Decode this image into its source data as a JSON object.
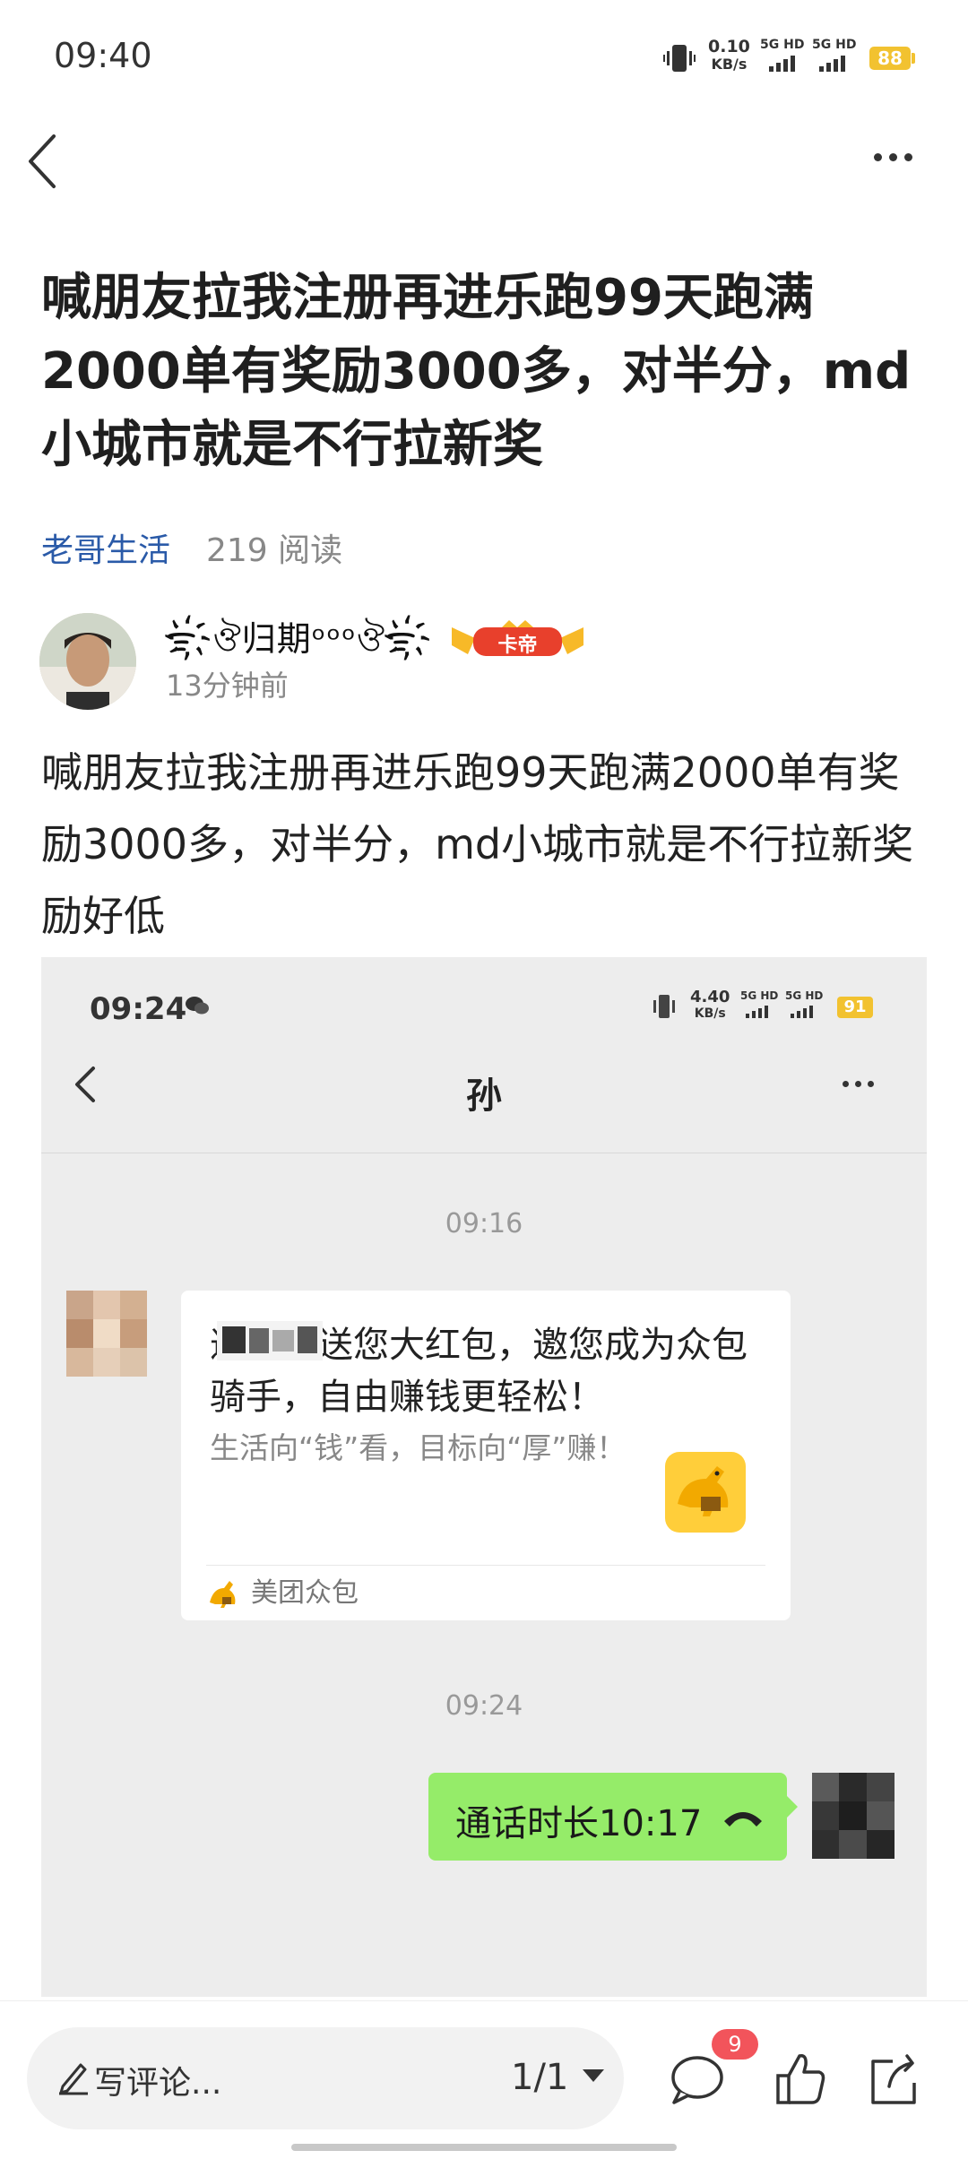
{
  "status_bar": {
    "time": "09:40",
    "net_speed_value": "0.10",
    "net_speed_unit": "KB/s",
    "sim1": "5G HD",
    "sim2": "5G HD",
    "battery": "88"
  },
  "nav": {
    "back_icon": "chevron-left-icon",
    "more_icon": "more-horizontal-icon"
  },
  "article": {
    "title": "喊朋友拉我注册再进乐跑99天跑满2000单有奖励3000多，对半分，md小城市就是不行拉新奖",
    "topic": "老哥生活",
    "reads": "219 阅读"
  },
  "author": {
    "name": "ᯤ҉ঔ归期ᵒᵒᵒঔᯤ҉",
    "badge": "卡帝",
    "time": "13分钟前"
  },
  "body_text": "喊朋友拉我注册再进乐跑99天跑满2000单有奖励3000多，对半分，md小城市就是不行拉新奖励好低",
  "screenshot": {
    "status_time": "09:24",
    "net_speed_value": "4.40",
    "net_speed_unit": "KB/s",
    "sim1": "5G HD",
    "sim2": "5G HD",
    "battery": "91",
    "chat_title": "孙",
    "stamp1": "09:16",
    "card_title": "邀请你送您大红包，邀您成为众包骑手，自由赚钱更轻松！",
    "card_desc": "生活向“钱”看，目标向“厚”赚！",
    "card_source": "美团众包",
    "stamp2": "09:24",
    "call_text": "通话时长10:17"
  },
  "bottom_bar": {
    "comment_placeholder": "写评论...",
    "page": "1/1",
    "comment_count": "9",
    "icons": [
      "pen-icon",
      "caret-down-icon",
      "comment-icon",
      "like-icon",
      "share-icon"
    ]
  },
  "colors": {
    "topic_link": "#2a5aa8",
    "badge_red": "#f2545b",
    "wechat_green": "#95ec69",
    "battery_yellow": "#f2c230"
  }
}
